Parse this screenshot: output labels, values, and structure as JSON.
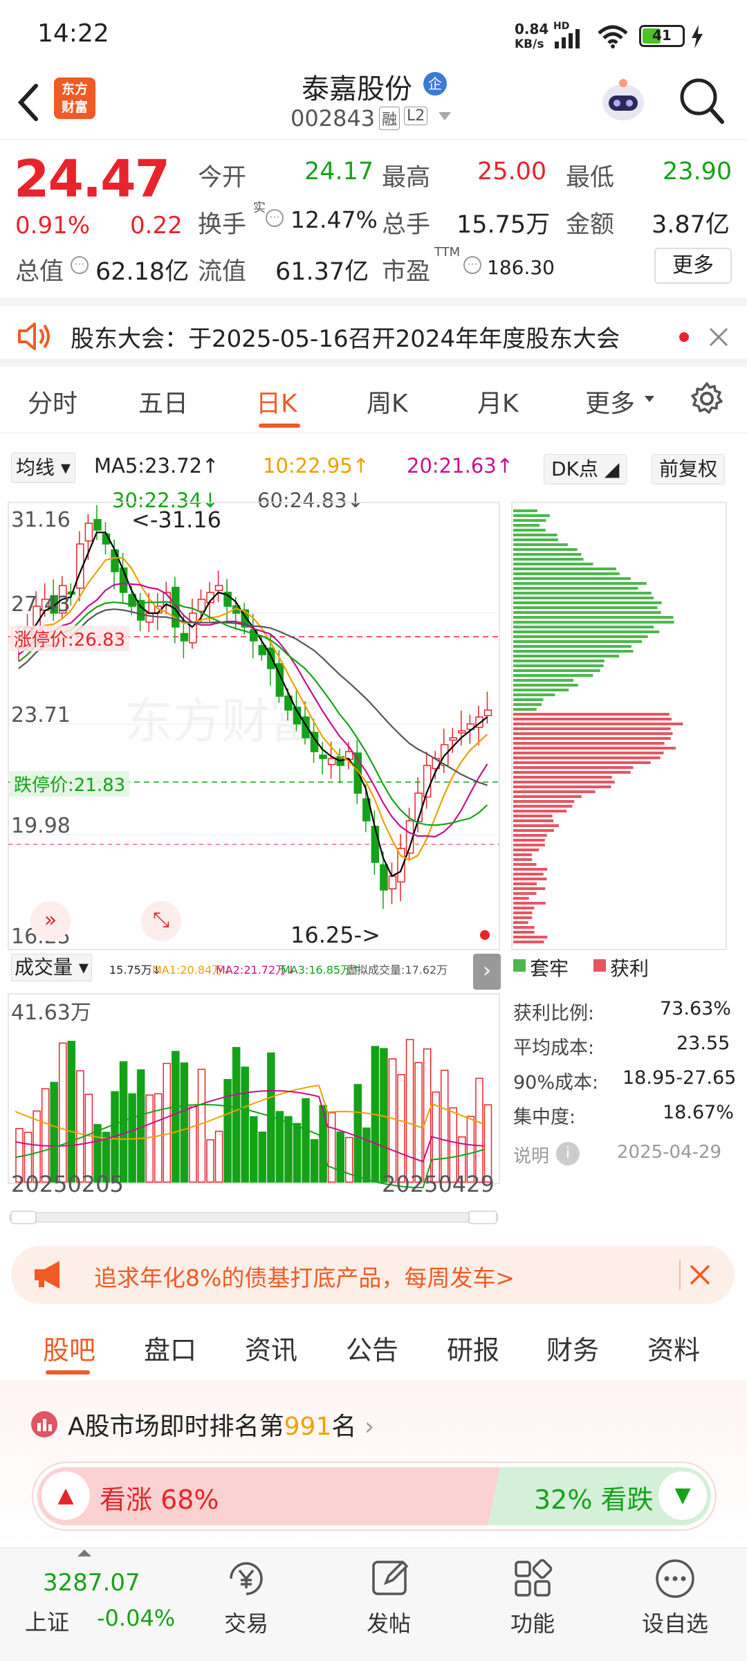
{
  "status": {
    "time": "14:22",
    "net_speed_top": "0.84",
    "net_speed_unit": "KB/s",
    "hd": "HD",
    "battery": "41"
  },
  "header": {
    "logo_line1": "东方",
    "logo_line2": "财富",
    "stock_name": "泰嘉股份",
    "badge": "企",
    "code": "002843",
    "margin_tag": "融",
    "level_tag": "L2"
  },
  "quote": {
    "price": "24.47",
    "change_pct": "0.91%",
    "change": "0.22",
    "open_label": "今开",
    "open": "24.17",
    "high_label": "最高",
    "high": "25.00",
    "low_label": "最低",
    "low": "23.90",
    "turnover_label": "换手",
    "turnover_sup": "实",
    "turnover": "12.47%",
    "volume_label": "总手",
    "volume": "15.75万",
    "amount_label": "金额",
    "amount": "3.87亿",
    "mktcap_label": "总值",
    "mktcap": "62.18亿",
    "float_label": "流值",
    "float": "61.37亿",
    "pe_label": "市盈",
    "pe_sup": "TTM",
    "pe": "186.30",
    "more": "更多"
  },
  "notice": {
    "text": "股东大会：于2025-05-16召开2024年年度股东大会"
  },
  "tabs": {
    "items": [
      "分时",
      "五日",
      "日K",
      "周K",
      "月K",
      "更多"
    ],
    "active": 2
  },
  "ma": {
    "selector": "均线",
    "ma5": "MA5:23.72↑",
    "ma10": "10:22.95↑",
    "ma20": "20:21.63↑",
    "ma30": "30:22.34↓",
    "ma60": "60:24.83↓",
    "dk": "DK点",
    "fq": "前复权"
  },
  "kline": {
    "y_labels": [
      "31.16",
      "27.43",
      "23.71",
      "19.98",
      "16.25"
    ],
    "high_mark": "<-31.16",
    "low_mark": "16.25->",
    "limit_up": "涨停价:26.83",
    "limit_down": "跌停价:21.83",
    "watermark": "东方财富"
  },
  "vol": {
    "selector": "成交量",
    "v": "15.75万↓",
    "ma1": "MA1:20.84万↓",
    "ma2": "MA2:21.72万↓",
    "ma3": "MA3:16.85万↑",
    "virtual": "虚拟成交量:17.62万",
    "max": "41.63万",
    "date_start": "20250205",
    "date_end": "20250429"
  },
  "chips": {
    "legend_loss": "套牢",
    "legend_profit": "获利",
    "rows": [
      {
        "k": "获利比例:",
        "v": "73.63%"
      },
      {
        "k": "平均成本:",
        "v": "23.55"
      },
      {
        "k": "90%成本:",
        "v": "18.95-27.65"
      },
      {
        "k": "集中度:",
        "v": "18.67%"
      }
    ],
    "note_label": "说明",
    "date": "2025-04-29"
  },
  "ad": {
    "text": "追求年化8%的债基打底产品，每周发车>"
  },
  "subtabs": {
    "items": [
      "股吧",
      "盘口",
      "资讯",
      "公告",
      "研报",
      "财务",
      "资料"
    ],
    "active": 0
  },
  "rank": {
    "prefix": "A股市场即时排名第",
    "num": "991",
    "suffix": "名",
    "up": "看涨 68%",
    "down": "32% 看跌",
    "up_frac": 0.68
  },
  "bottom": {
    "index_value": "3287.07",
    "index_name": "上证",
    "index_change": "-0.04%",
    "items": [
      "交易",
      "发帖",
      "功能",
      "设自选"
    ]
  },
  "colors": {
    "up": "#e8232b",
    "down": "#15a218",
    "accent": "#ff5a1f",
    "ma5": "#000000",
    "ma10": "#f0a000",
    "ma20": "#c8108c",
    "ma30": "#15a218",
    "ma60": "#555555"
  }
}
